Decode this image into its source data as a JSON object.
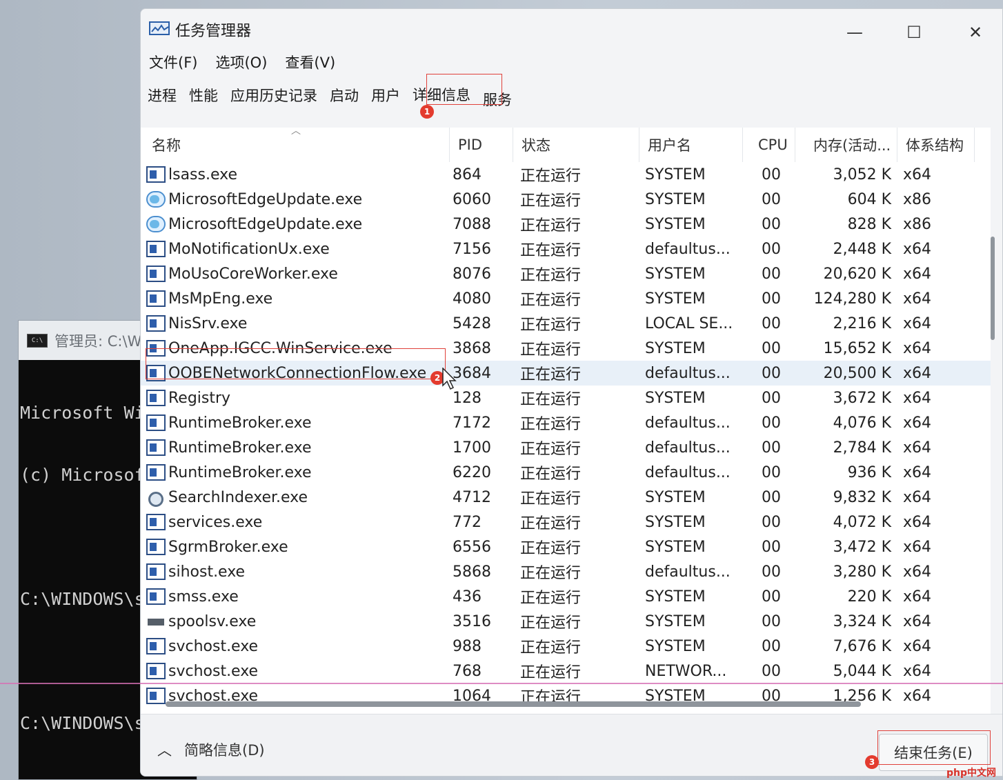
{
  "console": {
    "title": "管理员: C:\\W",
    "lines": [
      "Microsoft Wi",
      "(c) Microsof",
      "",
      "C:\\WINDOWS\\s",
      "",
      "C:\\WINDOWS\\s"
    ]
  },
  "window": {
    "title": "任务管理器",
    "controls": {
      "minimize": "—",
      "maximize": "☐",
      "close": "✕"
    }
  },
  "menu": [
    "文件(F)",
    "选项(O)",
    "查看(V)"
  ],
  "tabs": [
    "进程",
    "性能",
    "应用历史记录",
    "启动",
    "用户",
    "详细信息",
    "服务"
  ],
  "active_tab": "详细信息",
  "markers": [
    "1",
    "2",
    "3"
  ],
  "columns": {
    "name": "名称",
    "pid": "PID",
    "status": "状态",
    "user": "用户名",
    "cpu": "CPU",
    "memory": "内存(活动...",
    "arch": "体系结构"
  },
  "rows": [
    {
      "icon": "process-icon",
      "name": "lsass.exe",
      "pid": "864",
      "status": "正在运行",
      "user": "SYSTEM",
      "cpu": "00",
      "memory": "3,052 K",
      "arch": "x64"
    },
    {
      "icon": "edge-update-icon",
      "name": "MicrosoftEdgeUpdate.exe",
      "pid": "6060",
      "status": "正在运行",
      "user": "SYSTEM",
      "cpu": "00",
      "memory": "604 K",
      "arch": "x86"
    },
    {
      "icon": "edge-update-icon",
      "name": "MicrosoftEdgeUpdate.exe",
      "pid": "7088",
      "status": "正在运行",
      "user": "SYSTEM",
      "cpu": "00",
      "memory": "828 K",
      "arch": "x86"
    },
    {
      "icon": "process-icon",
      "name": "MoNotificationUx.exe",
      "pid": "7156",
      "status": "正在运行",
      "user": "defaultus...",
      "cpu": "00",
      "memory": "2,448 K",
      "arch": "x64"
    },
    {
      "icon": "process-icon",
      "name": "MoUsoCoreWorker.exe",
      "pid": "8076",
      "status": "正在运行",
      "user": "SYSTEM",
      "cpu": "00",
      "memory": "20,620 K",
      "arch": "x64"
    },
    {
      "icon": "process-icon",
      "name": "MsMpEng.exe",
      "pid": "4080",
      "status": "正在运行",
      "user": "SYSTEM",
      "cpu": "00",
      "memory": "124,280 K",
      "arch": "x64"
    },
    {
      "icon": "process-icon",
      "name": "NisSrv.exe",
      "pid": "5428",
      "status": "正在运行",
      "user": "LOCAL SE...",
      "cpu": "00",
      "memory": "2,216 K",
      "arch": "x64"
    },
    {
      "icon": "process-icon",
      "name": "OneApp.IGCC.WinService.exe",
      "pid": "3868",
      "status": "正在运行",
      "user": "SYSTEM",
      "cpu": "00",
      "memory": "15,652 K",
      "arch": "x64"
    },
    {
      "icon": "process-icon",
      "name": "OOBENetworkConnectionFlow.exe",
      "pid": "3684",
      "status": "正在运行",
      "user": "defaultus...",
      "cpu": "00",
      "memory": "20,500 K",
      "arch": "x64"
    },
    {
      "icon": "process-icon",
      "name": "Registry",
      "pid": "128",
      "status": "正在运行",
      "user": "SYSTEM",
      "cpu": "00",
      "memory": "3,672 K",
      "arch": "x64"
    },
    {
      "icon": "process-icon",
      "name": "RuntimeBroker.exe",
      "pid": "7172",
      "status": "正在运行",
      "user": "defaultus...",
      "cpu": "00",
      "memory": "4,076 K",
      "arch": "x64"
    },
    {
      "icon": "process-icon",
      "name": "RuntimeBroker.exe",
      "pid": "1700",
      "status": "正在运行",
      "user": "defaultus...",
      "cpu": "00",
      "memory": "2,784 K",
      "arch": "x64"
    },
    {
      "icon": "process-icon",
      "name": "RuntimeBroker.exe",
      "pid": "6220",
      "status": "正在运行",
      "user": "defaultus...",
      "cpu": "00",
      "memory": "936 K",
      "arch": "x64"
    },
    {
      "icon": "search-indexer-icon",
      "name": "SearchIndexer.exe",
      "pid": "4712",
      "status": "正在运行",
      "user": "SYSTEM",
      "cpu": "00",
      "memory": "9,832 K",
      "arch": "x64"
    },
    {
      "icon": "process-icon",
      "name": "services.exe",
      "pid": "772",
      "status": "正在运行",
      "user": "SYSTEM",
      "cpu": "00",
      "memory": "4,072 K",
      "arch": "x64"
    },
    {
      "icon": "process-icon",
      "name": "SgrmBroker.exe",
      "pid": "6556",
      "status": "正在运行",
      "user": "SYSTEM",
      "cpu": "00",
      "memory": "3,472 K",
      "arch": "x64"
    },
    {
      "icon": "process-icon",
      "name": "sihost.exe",
      "pid": "5868",
      "status": "正在运行",
      "user": "defaultus...",
      "cpu": "00",
      "memory": "3,280 K",
      "arch": "x64"
    },
    {
      "icon": "process-icon",
      "name": "smss.exe",
      "pid": "436",
      "status": "正在运行",
      "user": "SYSTEM",
      "cpu": "00",
      "memory": "220 K",
      "arch": "x64"
    },
    {
      "icon": "printer-icon",
      "name": "spoolsv.exe",
      "pid": "3516",
      "status": "正在运行",
      "user": "SYSTEM",
      "cpu": "00",
      "memory": "3,324 K",
      "arch": "x64"
    },
    {
      "icon": "process-icon",
      "name": "svchost.exe",
      "pid": "988",
      "status": "正在运行",
      "user": "SYSTEM",
      "cpu": "00",
      "memory": "7,676 K",
      "arch": "x64"
    },
    {
      "icon": "process-icon",
      "name": "svchost.exe",
      "pid": "768",
      "status": "正在运行",
      "user": "NETWOR...",
      "cpu": "00",
      "memory": "5,044 K",
      "arch": "x64"
    },
    {
      "icon": "process-icon",
      "name": "svchost.exe",
      "pid": "1064",
      "status": "正在运行",
      "user": "SYSTEM",
      "cpu": "00",
      "memory": "1,256 K",
      "arch": "x64"
    }
  ],
  "footer": {
    "brief_label": "简略信息(D)",
    "end_task_label": "结束任务(E)"
  },
  "watermark": "php中文网"
}
